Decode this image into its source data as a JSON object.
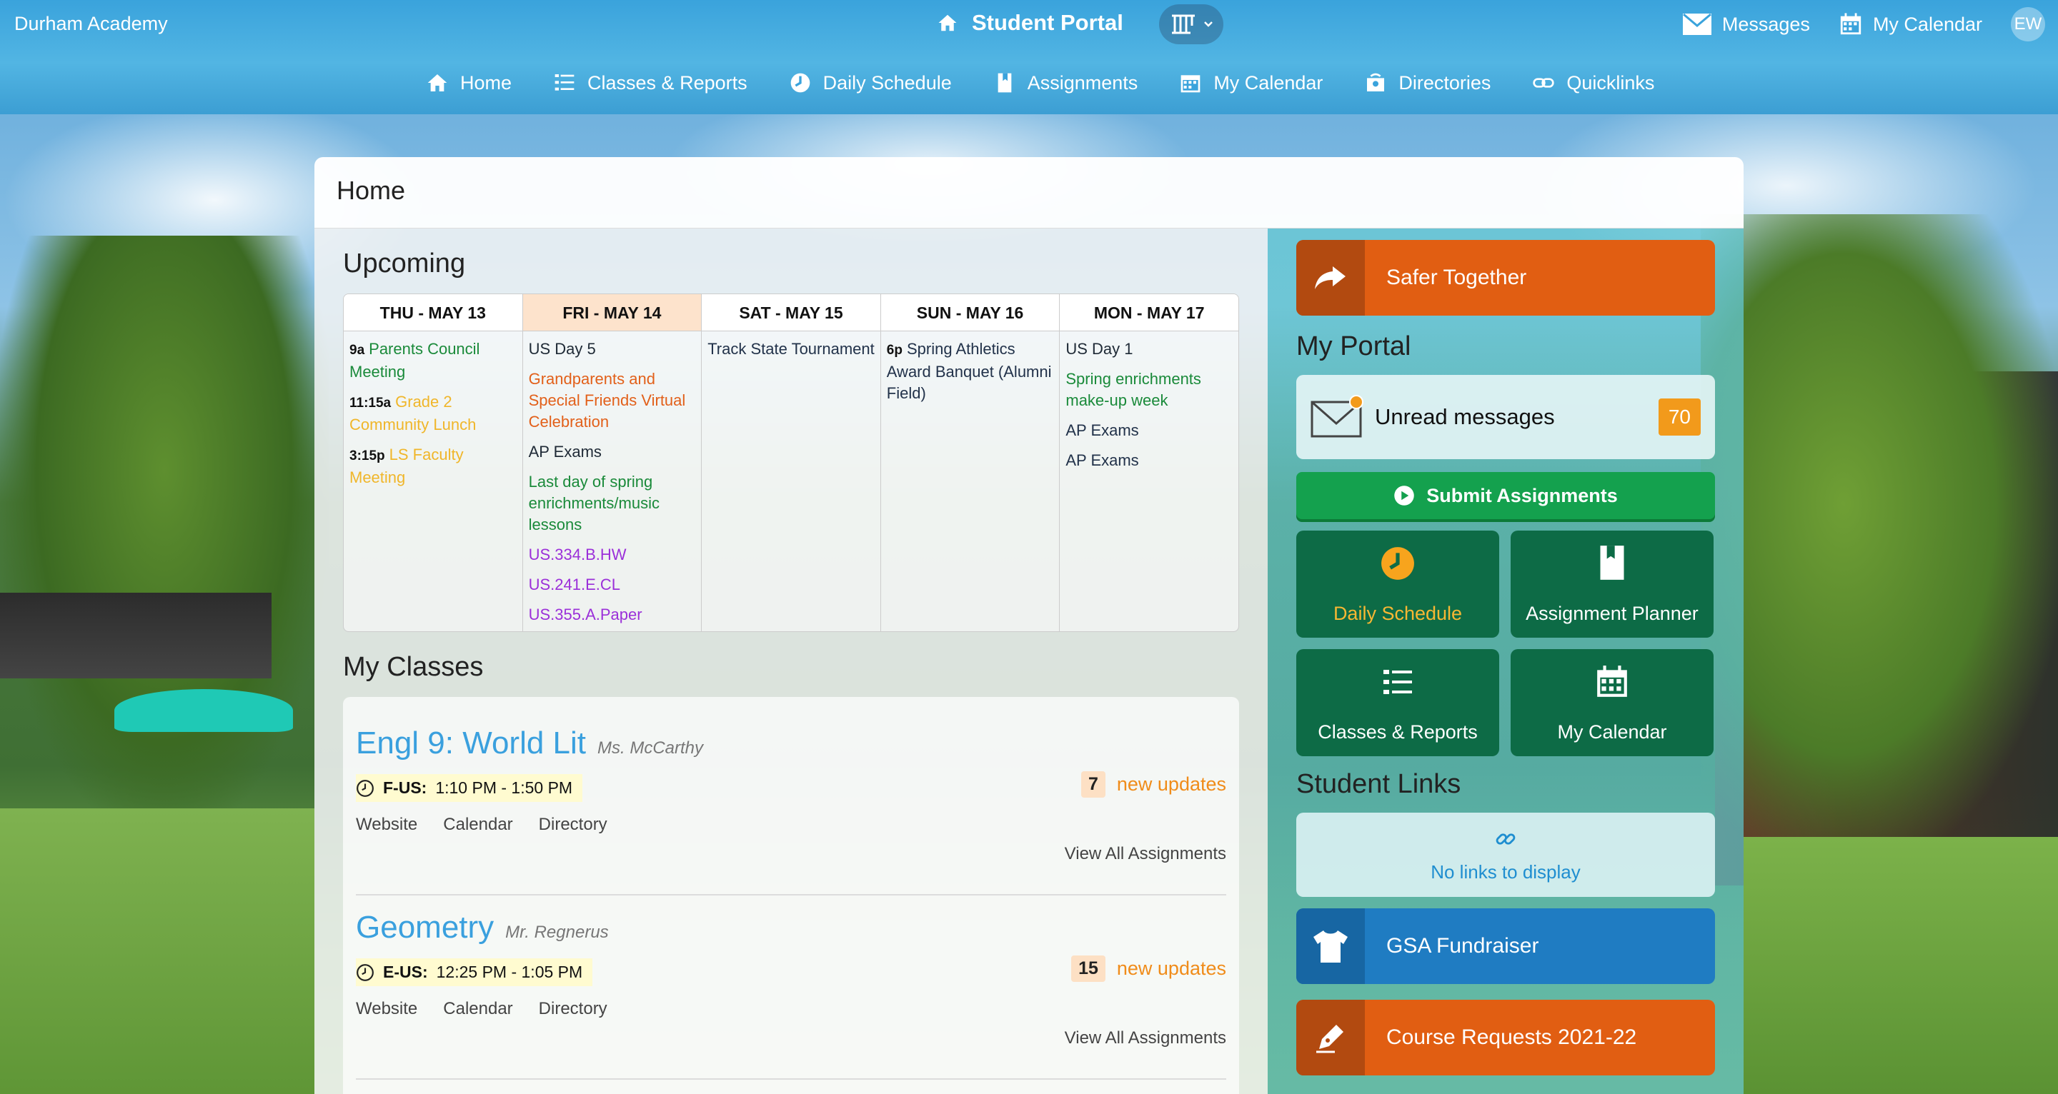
{
  "header": {
    "brand": "Durham Academy",
    "portal_title": "Student Portal",
    "messages_label": "Messages",
    "calendar_label": "My Calendar",
    "avatar_initials": "EW"
  },
  "nav": {
    "items": [
      {
        "label": "Home",
        "icon": "home-icon"
      },
      {
        "label": "Classes & Reports",
        "icon": "list-icon"
      },
      {
        "label": "Daily Schedule",
        "icon": "clock-icon"
      },
      {
        "label": "Assignments",
        "icon": "bookmark-icon"
      },
      {
        "label": "My Calendar",
        "icon": "calendar-icon"
      },
      {
        "label": "Directories",
        "icon": "directory-icon"
      },
      {
        "label": "Quicklinks",
        "icon": "link-icon"
      }
    ]
  },
  "page": {
    "title": "Home"
  },
  "upcoming": {
    "heading": "Upcoming",
    "days": [
      {
        "label": "THU - MAY 13",
        "events": [
          {
            "time": "9a",
            "text": "Parents Council Meeting",
            "color": "green"
          },
          {
            "time": "11:15a",
            "text": "Grade 2 Community Lunch",
            "color": "yellow"
          },
          {
            "time": "3:15p",
            "text": "LS Faculty Meeting",
            "color": "yellow"
          }
        ]
      },
      {
        "label": "FRI - MAY 14",
        "events": [
          {
            "time": "",
            "text": "US Day 5",
            "color": "dark"
          },
          {
            "time": "",
            "text": "Grandparents and Special Friends Virtual Celebration",
            "color": "orange"
          },
          {
            "time": "",
            "text": "AP Exams",
            "color": "dark"
          },
          {
            "time": "",
            "text": "Last day of spring enrichments/music lessons",
            "color": "green"
          },
          {
            "time": "",
            "text": "US.334.B.HW",
            "color": "purple"
          },
          {
            "time": "",
            "text": "US.241.E.CL",
            "color": "purple"
          },
          {
            "time": "",
            "text": "US.355.A.Paper",
            "color": "purple"
          }
        ]
      },
      {
        "label": "SAT - MAY 15",
        "events": [
          {
            "time": "",
            "text": "Track State Tournament",
            "color": "navy"
          }
        ]
      },
      {
        "label": "SUN - MAY 16",
        "events": [
          {
            "time": "6p",
            "text": "Spring Athletics Award Banquet (Alumni Field)",
            "color": "navy"
          }
        ]
      },
      {
        "label": "MON - MAY 17",
        "events": [
          {
            "time": "",
            "text": "US Day 1",
            "color": "dark"
          },
          {
            "time": "",
            "text": "Spring enrichments make-up week",
            "color": "green"
          },
          {
            "time": "",
            "text": "AP Exams",
            "color": "dark"
          },
          {
            "time": "",
            "text": "AP Exams",
            "color": "dark"
          }
        ]
      }
    ]
  },
  "classes": {
    "heading": "My Classes",
    "items": [
      {
        "title": "Engl 9: World Lit",
        "teacher": "Ms. McCarthy",
        "block": "F-US:",
        "time": "1:10 PM - 1:50 PM",
        "updates_count": "7",
        "updates_label": "new updates",
        "links": [
          "Website",
          "Calendar",
          "Directory"
        ],
        "view_all": "View All Assignments"
      },
      {
        "title": "Geometry",
        "teacher": "Mr. Regnerus",
        "block": "E-US:",
        "time": "12:25 PM - 1:05 PM",
        "updates_count": "15",
        "updates_label": "new updates",
        "links": [
          "Website",
          "Calendar",
          "Directory"
        ],
        "view_all": "View All Assignments"
      }
    ]
  },
  "sidebar": {
    "safer_together": "Safer Together",
    "my_portal_heading": "My Portal",
    "unread_label": "Unread messages",
    "unread_count": "70",
    "submit_label": "Submit Assignments",
    "tiles": [
      {
        "label": "Daily Schedule",
        "icon": "clock-icon"
      },
      {
        "label": "Assignment Planner",
        "icon": "bookmark-icon"
      },
      {
        "label": "Classes & Reports",
        "icon": "list-icon"
      },
      {
        "label": "My Calendar",
        "icon": "calendar-icon"
      }
    ],
    "student_links_heading": "Student Links",
    "no_links": "No links to display",
    "gsa_fundraiser": "GSA Fundraiser",
    "course_requests": "Course Requests 2021-22"
  },
  "colors": {
    "header_blue": "#3aa3dc",
    "accent_orange": "#e15e12",
    "tile_green": "#0d6b46",
    "submit_green": "#14a14e",
    "badge_orange": "#f29a1b",
    "link_blue": "#3aa0de"
  }
}
